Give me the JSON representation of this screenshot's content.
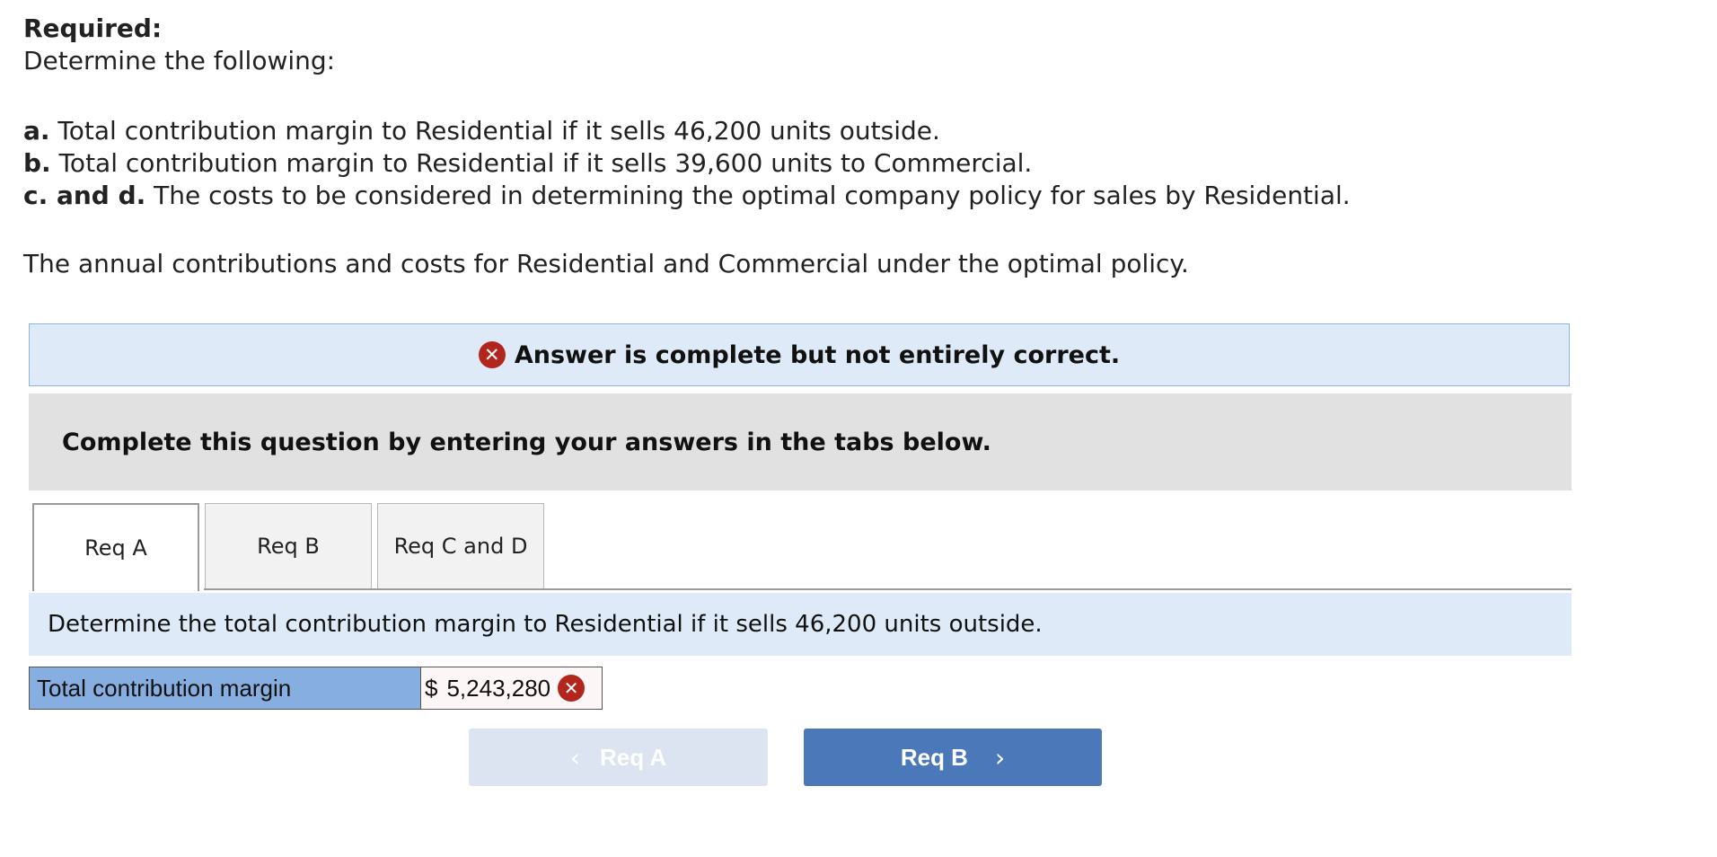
{
  "intro": {
    "required_label": "Required:",
    "determine": "Determine the following:",
    "items": [
      {
        "key": "a.",
        "text": " Total contribution margin to Residential if it sells 46,200 units outside."
      },
      {
        "key": "b.",
        "text": " Total contribution margin to Residential if it sells 39,600 units to Commercial."
      },
      {
        "key": "c. and d.",
        "text": " The costs to be considered in determining the optimal company policy for sales by Residential."
      }
    ],
    "closing": "The annual contributions and costs for Residential and Commercial under the optimal policy."
  },
  "feedback": {
    "icon": "x-circle-icon",
    "message": "Answer is complete but not entirely correct.",
    "icon_color": "#b3261e"
  },
  "instruction": "Complete this question by entering your answers in the tabs below.",
  "tabs": [
    {
      "label": "Req A",
      "active": true
    },
    {
      "label": "Req B",
      "active": false
    },
    {
      "label": "Req C and D",
      "active": false
    }
  ],
  "question": "Determine the total contribution margin to Residential if it sells 46,200 units outside.",
  "answer": {
    "label": "Total contribution margin",
    "currency": "$",
    "value": "5,243,280",
    "status_icon": "x-circle-icon"
  },
  "nav": {
    "prev_label": "Req A",
    "next_label": "Req B",
    "prev_color": "#dbe4f0",
    "next_color": "#4a78b8"
  }
}
